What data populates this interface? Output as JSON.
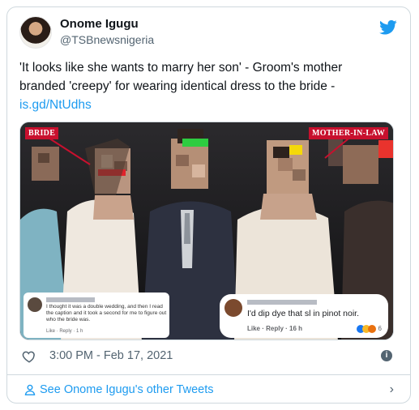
{
  "user": {
    "name": "Onome Igugu",
    "handle": "@TSBnewsnigeria"
  },
  "tweet": {
    "text": "'It looks like she wants to marry her son' - Groom's mother branded 'creepy' for wearing identical dress to the bride -",
    "link": "is.gd/NtUdhs",
    "timestamp": "3:00 PM - Feb 17, 2021"
  },
  "media": {
    "label_left": "BRIDE",
    "label_right": "MOTHER-IN-LAW",
    "comment_left": {
      "text": "I thought it was a double wedding, and then I read the caption and it took a second for me to figure out who the bride was.",
      "meta": "Like · Reply · 1 h"
    },
    "comment_right": {
      "text": "I'd dip dye that sl    in pinot noir.",
      "meta": "Like · Reply · 16 h",
      "reactions": "6"
    }
  },
  "footer": {
    "link_text": "See Onome Igugu's other Tweets"
  },
  "colors": {
    "accent": "#1d9bf0",
    "label_red": "#c8102e",
    "muted": "#536471"
  },
  "icons": [
    "twitter-bird-icon",
    "heart-icon",
    "info-icon",
    "person-icon",
    "chevron-right-icon"
  ]
}
